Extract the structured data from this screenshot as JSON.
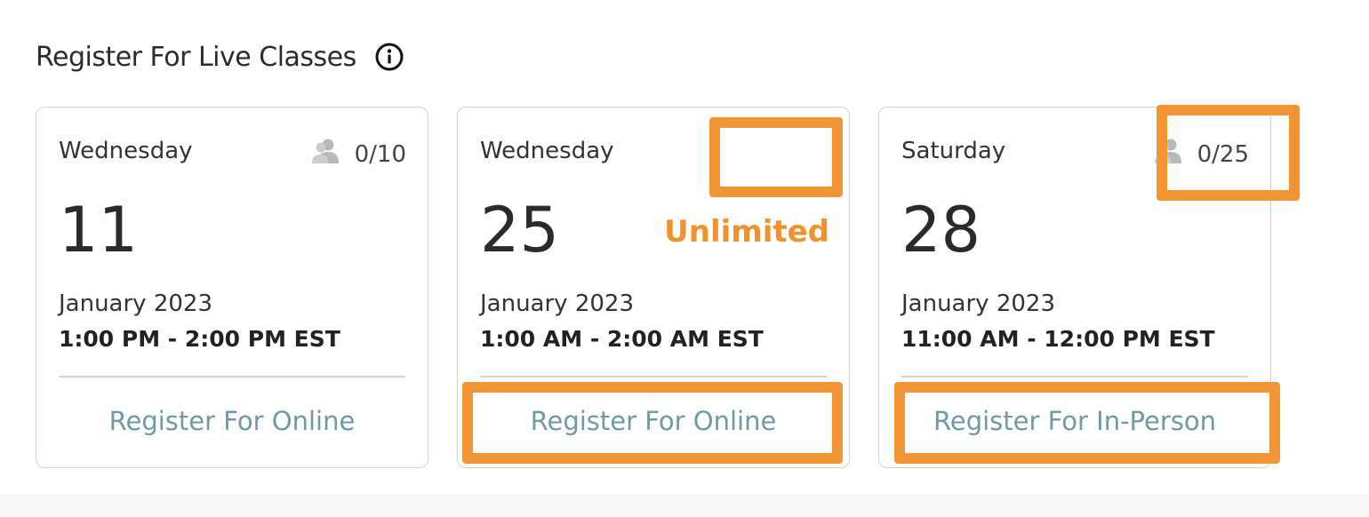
{
  "header": {
    "title": "Register For Live Classes",
    "info_icon": "info-circle-icon"
  },
  "cards": [
    {
      "day": "Wednesday",
      "date": "11",
      "month_year": "January 2023",
      "time": "1:00 PM - 2:00 PM EST",
      "capacity": "0/10",
      "capacity_icon": "person-icon",
      "register_label": "Register For Online"
    },
    {
      "day": "Wednesday",
      "date": "25",
      "month_year": "January 2023",
      "time": "1:00 AM - 2:00 AM EST",
      "capacity_status": "Unlimited",
      "register_label": "Register For Online"
    },
    {
      "day": "Saturday",
      "date": "28",
      "month_year": "January 2023",
      "time": "11:00 AM - 12:00 PM EST",
      "capacity": "0/25",
      "capacity_icon": "person-icon",
      "register_label": "Register For In-Person"
    }
  ],
  "colors": {
    "highlight": "#f29535",
    "link": "#6e9aa3",
    "unlimited": "#f0932d",
    "card_border": "#d4d4d4"
  }
}
